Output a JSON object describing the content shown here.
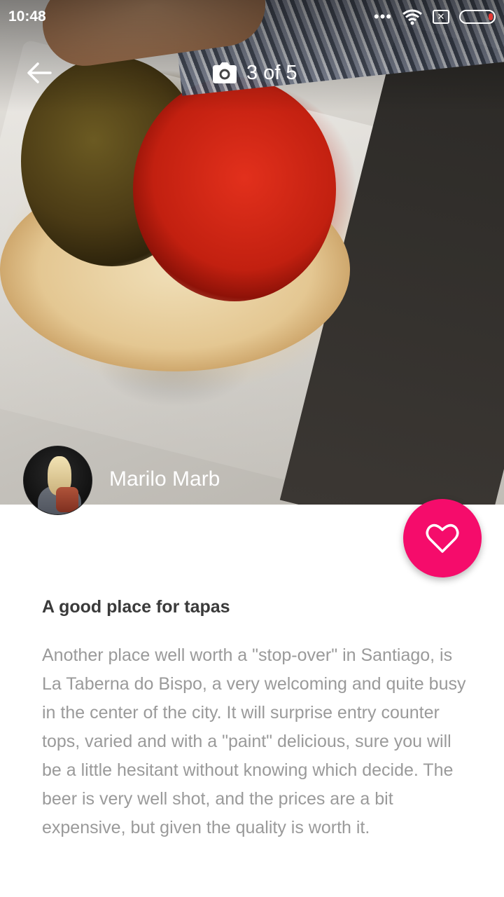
{
  "status_bar": {
    "time": "10:48",
    "icons": [
      "more-dots-icon",
      "wifi-icon",
      "no-sim-icon",
      "battery-icon"
    ]
  },
  "toolbar": {
    "back_icon": "arrow-left-icon",
    "camera_icon": "camera-icon",
    "photo_counter": "3 of 5"
  },
  "author": {
    "name": "Marilo Marb"
  },
  "favorite": {
    "icon": "heart-outline-icon",
    "color": "#f50c6b"
  },
  "review": {
    "title": "A good place for tapas",
    "body": "Another place well worth a \"stop-over\" in Santiago, is La Taberna do Bispo, a very welcoming and quite busy in the center of the city. It will surprise entry counter tops, varied and with a \"paint\" delicious, sure you will be a little hesitant without knowing which decide. The beer is very well shot, and the prices are a bit expensive, but given the quality is worth it."
  }
}
